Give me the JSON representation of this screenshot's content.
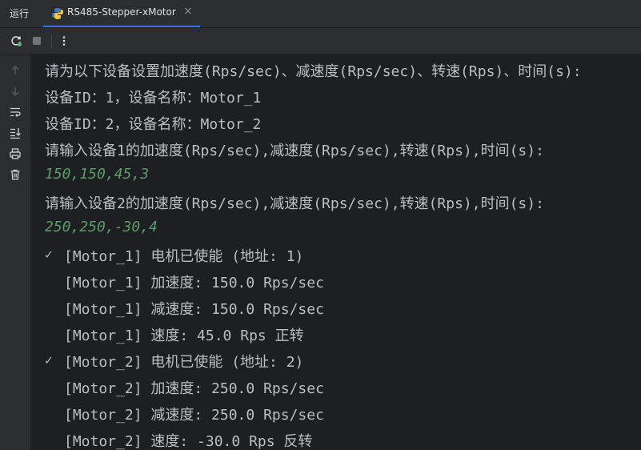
{
  "tabbar": {
    "run_label": "运行",
    "tab_title": "RS485-Stepper-xMotor",
    "close_glyph": "×"
  },
  "console": {
    "lines": [
      "请为以下设备设置加速度(Rps/sec)、减速度(Rps/sec)、转速(Rps)、时间(s):",
      "设备ID：1，设备名称：Motor_1",
      "设备ID：2，设备名称：Motor_2",
      "请输入设备1的加速度(Rps/sec),减速度(Rps/sec),转速(Rps),时间(s):",
      "150,150,45,3",
      "请输入设备2的加速度(Rps/sec),减速度(Rps/sec),转速(Rps),时间(s):",
      "250,250,-30,4",
      "[Motor_1] 电机已使能 (地址: 1)",
      "[Motor_1] 加速度: 150.0 Rps/sec",
      "[Motor_1] 减速度: 150.0 Rps/sec",
      "[Motor_1] 速度: 45.0 Rps 正转",
      "[Motor_2] 电机已使能 (地址: 2)",
      "[Motor_2] 加速度: 250.0 Rps/sec",
      "[Motor_2] 减速度: 250.0 Rps/sec",
      "[Motor_2] 速度: -30.0 Rps 反转"
    ],
    "check_glyph": "✓"
  },
  "colors": {
    "input_text": "#5c9c6a",
    "output_text": "#bcbec4",
    "accent": "#3574f0"
  }
}
